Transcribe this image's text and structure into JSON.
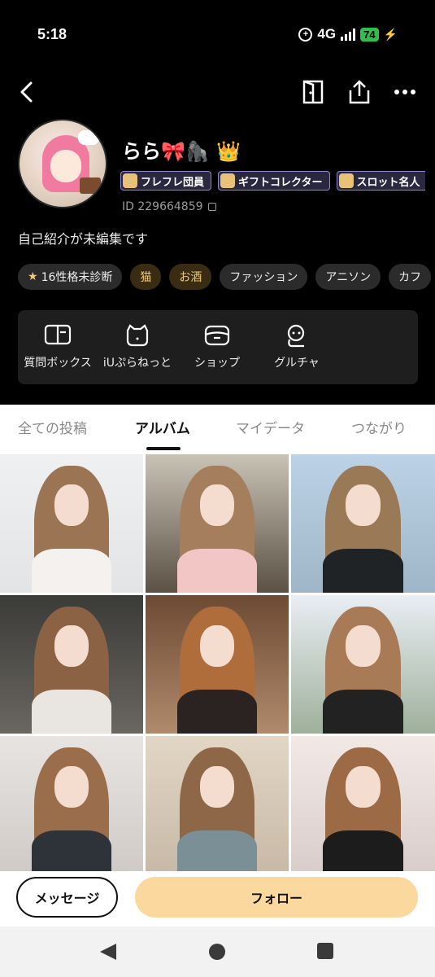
{
  "status_bar": {
    "time": "5:18",
    "network": "4G",
    "battery": "74"
  },
  "profile": {
    "name": "らら🎀🦍 👑",
    "badges": [
      "フレフレ団員",
      "ギフトコレクター",
      "スロット名人"
    ],
    "id_label": "ID 229664859",
    "bio": "自己紹介が未編集です"
  },
  "tags": [
    {
      "label": "16性格未診断",
      "style": "dark",
      "icon": "star-icon"
    },
    {
      "label": "猫",
      "style": "gold"
    },
    {
      "label": "お酒",
      "style": "gold"
    },
    {
      "label": "ファッション",
      "style": "dark"
    },
    {
      "label": "アニソン",
      "style": "dark"
    },
    {
      "label": "カフ",
      "style": "dark"
    }
  ],
  "features": [
    {
      "label": "質問ボックス",
      "icon": "question-box-icon"
    },
    {
      "label": "iUぷらねっと",
      "icon": "planet-icon"
    },
    {
      "label": "ショップ",
      "icon": "shop-icon"
    },
    {
      "label": "グルチャ",
      "icon": "group-chat-icon"
    }
  ],
  "tabs": [
    {
      "label": "全ての投稿",
      "active": false
    },
    {
      "label": "アルバム",
      "active": true
    },
    {
      "label": "マイデータ",
      "active": false
    },
    {
      "label": "つながり",
      "active": false
    }
  ],
  "actions": {
    "message": "メッセージ",
    "follow": "フォロー"
  },
  "colors": {
    "follow_button": "#fbd89d",
    "gold_tag_text": "#f3c979",
    "badge_border": "#8f86c9",
    "battery": "#2fbf4a"
  }
}
